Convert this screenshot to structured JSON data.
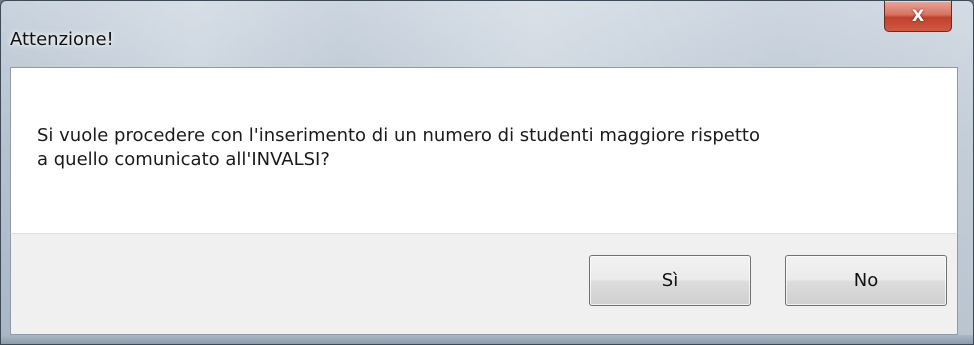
{
  "window": {
    "title": "Attenzione!",
    "close_icon": "close-icon",
    "close_glyph": "X"
  },
  "message": {
    "line1": "Si vuole procedere con l'inserimento di un numero di studenti maggiore rispetto",
    "line2": "a quello comunicato all'INVALSI?"
  },
  "buttons": {
    "yes_label": "Sì",
    "no_label": "No"
  },
  "colors": {
    "close_button": "#c0412c",
    "content_bg": "#ffffff",
    "button_area_bg": "#f0f0f0"
  }
}
